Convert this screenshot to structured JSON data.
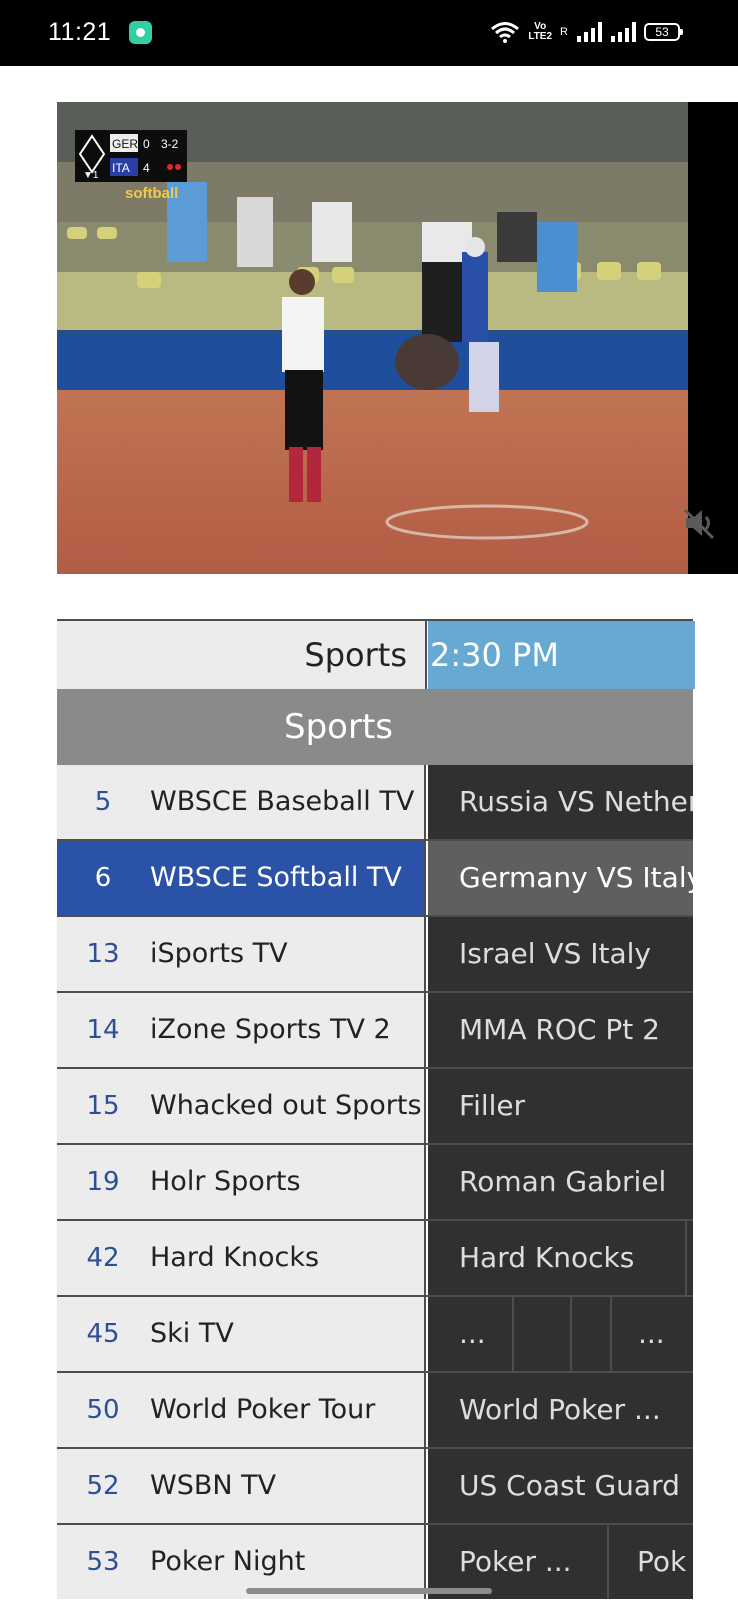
{
  "status_bar": {
    "time": "11:21",
    "volte_top": "Vo",
    "volte_bottom": "LTE2",
    "roaming": "R",
    "battery": "53"
  },
  "video": {
    "scoreboard": {
      "team1": "GER",
      "team1_score": "0",
      "team2": "ITA",
      "team2_score": "4",
      "count": "3-2",
      "inning": "▼1",
      "brand": "softball"
    }
  },
  "guide": {
    "header_label": "Sports",
    "header_time": "2:30 PM",
    "category": "Sports",
    "rows": [
      {
        "num": "5",
        "name": "WBSCE Baseball TV",
        "program": "Russia VS Netherlands"
      },
      {
        "num": "6",
        "name": "WBSCE Softball TV",
        "program": "Germany VS Italy"
      },
      {
        "num": "13",
        "name": "iSports TV",
        "program": "Israel VS Italy"
      },
      {
        "num": "14",
        "name": "iZone Sports TV 2",
        "program": "MMA ROC Pt 2"
      },
      {
        "num": "15",
        "name": "Whacked out Sports",
        "program": "Filler"
      },
      {
        "num": "19",
        "name": "Holr Sports",
        "program": "Roman Gabriel"
      },
      {
        "num": "42",
        "name": "Hard Knocks",
        "program": "Hard Knocks"
      },
      {
        "num": "45",
        "name": "Ski TV",
        "slots": [
          "...",
          "",
          "",
          "..."
        ]
      },
      {
        "num": "50",
        "name": "World Poker Tour",
        "program": "World Poker ..."
      },
      {
        "num": "52",
        "name": "WSBN TV",
        "program": "US Coast Guard"
      },
      {
        "num": "53",
        "name": "Poker Night",
        "slots": [
          "Poker ...",
          "Pok"
        ]
      }
    ]
  }
}
